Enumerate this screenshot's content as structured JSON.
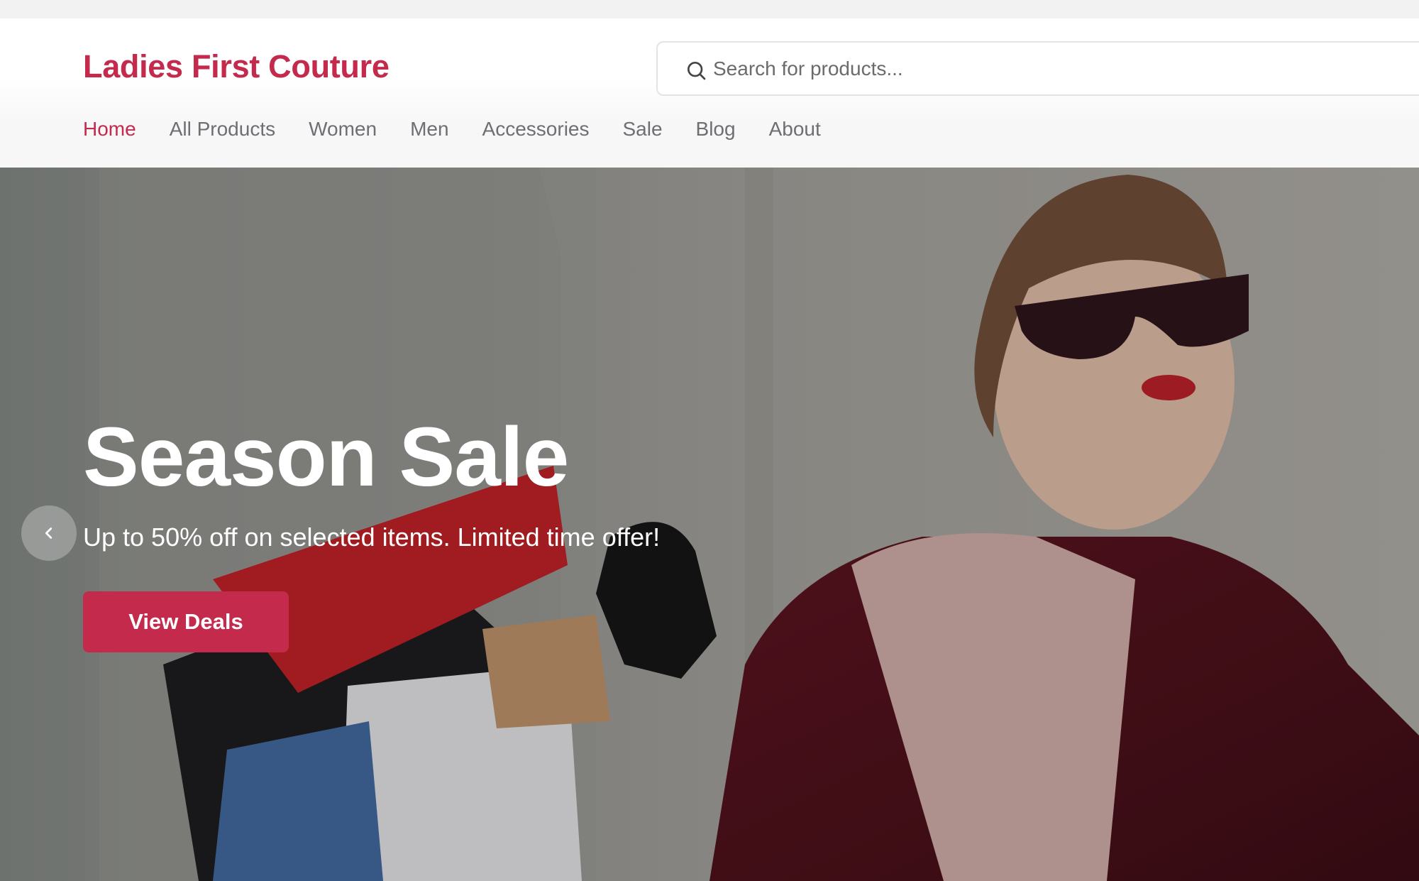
{
  "header": {
    "logo": "Ladies First Couture",
    "search": {
      "placeholder": "Search for products...",
      "icon": "search-icon"
    }
  },
  "nav": {
    "items": [
      {
        "label": "Home",
        "active": true
      },
      {
        "label": "All Products"
      },
      {
        "label": "Women"
      },
      {
        "label": "Men"
      },
      {
        "label": "Accessories"
      },
      {
        "label": "Sale"
      },
      {
        "label": "Blog"
      },
      {
        "label": "About"
      }
    ]
  },
  "hero": {
    "title": "Season Sale",
    "subtitle": "Up to 50% off on selected items. Limited time offer!",
    "cta": "View Deals",
    "prev_icon": "chevron-left-icon"
  },
  "colors": {
    "brand": "#c32a4b",
    "nav_text": "#6e6e73"
  }
}
